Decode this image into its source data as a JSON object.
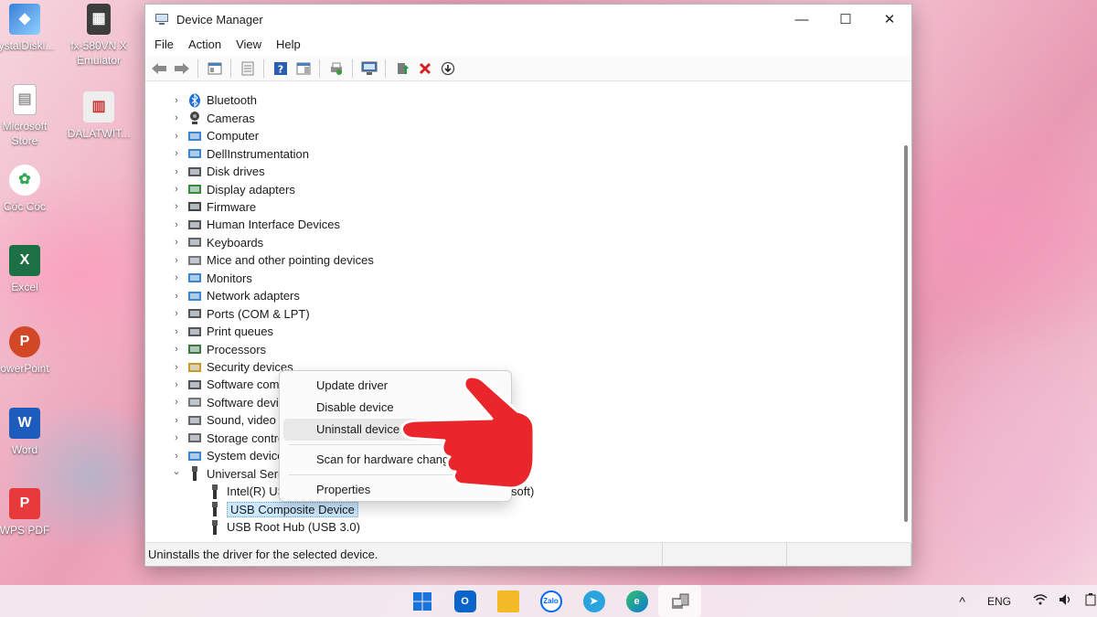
{
  "desktop": {
    "icons": [
      {
        "label": "rystalDiskl..."
      },
      {
        "label": "fx-580VN X Emulator"
      },
      {
        "label": "Microsoft Store"
      },
      {
        "label": "DALATWIT..."
      },
      {
        "label": "Cốc Cốc"
      },
      {
        "label": "Excel"
      },
      {
        "label": "owerPoint"
      },
      {
        "label": "Word"
      },
      {
        "label": "WPS PDF"
      }
    ]
  },
  "window": {
    "title": "Device Manager",
    "controls": {
      "minimize": "—",
      "maximize": "☐",
      "close": "✕"
    },
    "menu": [
      "File",
      "Action",
      "View",
      "Help"
    ],
    "tree": {
      "categories": [
        {
          "label": "Bluetooth",
          "icon": "bluetooth-icon"
        },
        {
          "label": "Cameras",
          "icon": "camera-icon"
        },
        {
          "label": "Computer",
          "icon": "computer-icon"
        },
        {
          "label": "DellInstrumentation",
          "icon": "monitor-icon"
        },
        {
          "label": "Disk drives",
          "icon": "disk-drive-icon"
        },
        {
          "label": "Display adapters",
          "icon": "display-adapter-icon"
        },
        {
          "label": "Firmware",
          "icon": "firmware-icon"
        },
        {
          "label": "Human Interface Devices",
          "icon": "hid-icon"
        },
        {
          "label": "Keyboards",
          "icon": "keyboard-icon"
        },
        {
          "label": "Mice and other pointing devices",
          "icon": "mouse-icon"
        },
        {
          "label": "Monitors",
          "icon": "monitor-icon"
        },
        {
          "label": "Network adapters",
          "icon": "network-icon"
        },
        {
          "label": "Ports (COM & LPT)",
          "icon": "port-icon"
        },
        {
          "label": "Print queues",
          "icon": "printer-icon"
        },
        {
          "label": "Processors",
          "icon": "processor-icon"
        },
        {
          "label": "Security devices",
          "icon": "security-icon"
        },
        {
          "label": "Software comp",
          "icon": "software-component-icon"
        },
        {
          "label": "Software devic",
          "icon": "software-device-icon"
        },
        {
          "label": "Sound, video a",
          "icon": "sound-icon"
        },
        {
          "label": "Storage contro",
          "icon": "storage-icon"
        },
        {
          "label": "System device",
          "icon": "system-icon"
        },
        {
          "label": "Universal Seria",
          "icon": "usb-icon"
        }
      ],
      "usb_children": [
        {
          "label": "Intel(R) US",
          "suffix": "soft)"
        },
        {
          "label": "USB Composite Device"
        },
        {
          "label": "USB Root Hub (USB 3.0)"
        }
      ]
    },
    "status_text": "Uninstalls the driver for the selected device."
  },
  "context_menu": {
    "items": [
      "Update driver",
      "Disable device",
      "Uninstall device",
      "Scan for hardware changes",
      "Properties"
    ],
    "hovered": "Uninstall device"
  },
  "taskbar": {
    "tray": {
      "language": "ENG",
      "chevron": "^"
    }
  },
  "colors": {
    "hand": "#e8262b",
    "selection": "#cce8ff",
    "accent": "#0067c0"
  }
}
